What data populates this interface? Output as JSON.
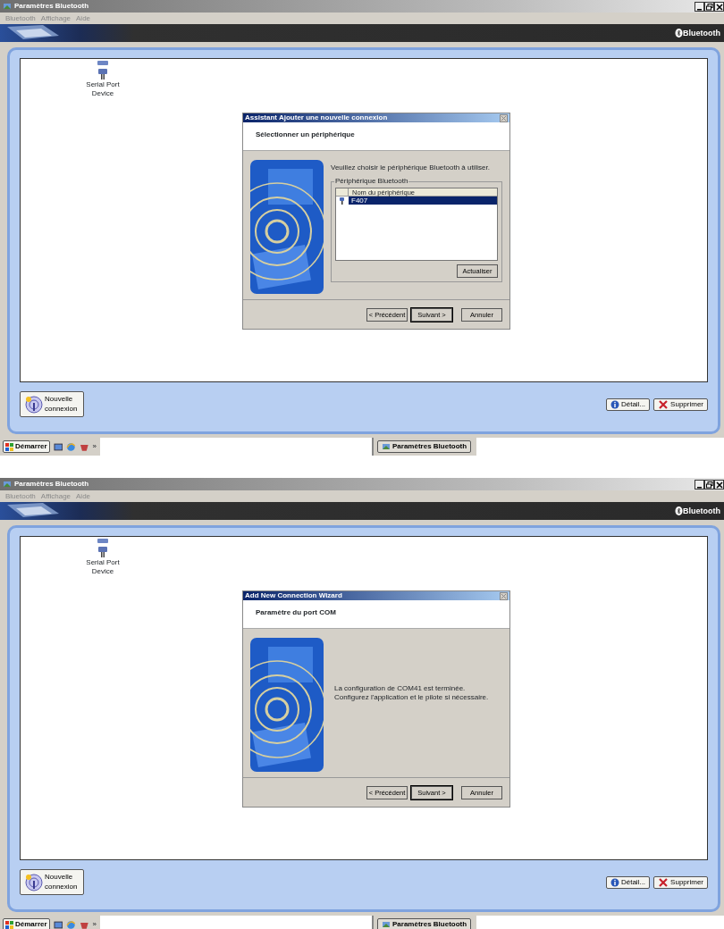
{
  "screens": [
    {
      "window": {
        "title": "Paramètres Bluetooth"
      },
      "menu": [
        "Bluetooth",
        "Affichage",
        "Aide"
      ],
      "brand": "Bluetooth",
      "devices": [
        {
          "label": "Serial Port Device"
        }
      ],
      "wizard": {
        "kind": "device_select",
        "title": "Assistant Ajouter une nouvelle connexion",
        "heading": "Sélectionner un périphérique",
        "instruction": "Veuillez choisir le périphérique Bluetooth à utiliser.",
        "group": "Périphérique Bluetooth",
        "column": "Nom du périphérique",
        "items": [
          {
            "name": "F407",
            "selected": true
          }
        ],
        "refresh": "Actualiser",
        "buttons": [
          {
            "label": "< Précédent",
            "default": false
          },
          {
            "label": "Suivant >",
            "default": true
          },
          {
            "label": "Annuler",
            "default": false
          }
        ]
      },
      "actions": {
        "new": "Nouvelle connexion",
        "detail": "Détail...",
        "delete": "Supprimer"
      },
      "taskbar": {
        "start": "Démarrer",
        "more": "»",
        "task": "Paramètres Bluetooth"
      }
    },
    {
      "window": {
        "title": "Paramètres Bluetooth"
      },
      "menu": [
        "Bluetooth",
        "Affichage",
        "Aide"
      ],
      "brand": "Bluetooth",
      "devices": [
        {
          "label": "Serial Port Device"
        }
      ],
      "wizard": {
        "kind": "message",
        "title": "Add New Connection Wizard",
        "heading": "Paramètre du port COM",
        "lines": [
          "La configuration de COM41 est terminée.",
          "Configurez l'application et le pilote si nécessaire."
        ],
        "buttons": [
          {
            "label": "< Précédent",
            "default": false
          },
          {
            "label": "Suivant >",
            "default": true
          },
          {
            "label": "Annuler",
            "default": false
          }
        ]
      },
      "actions": {
        "new": "Nouvelle connexion",
        "detail": "Détail...",
        "delete": "Supprimer"
      },
      "taskbar": {
        "start": "Démarrer",
        "more": "»",
        "task": "Paramètres Bluetooth"
      }
    }
  ]
}
